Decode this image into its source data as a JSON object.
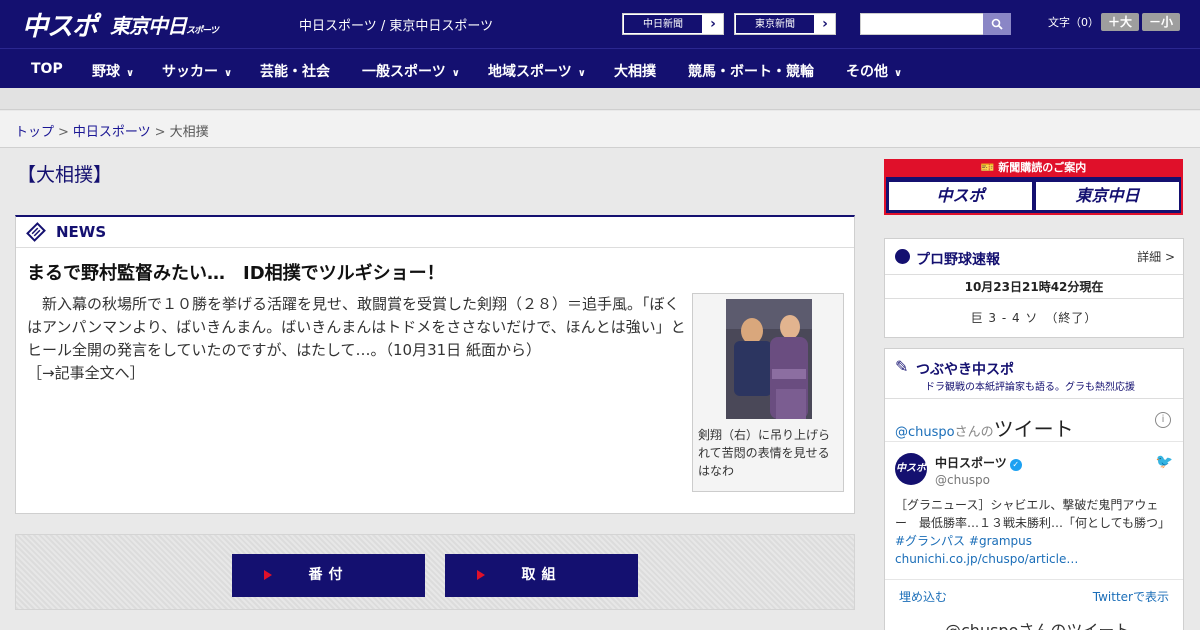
{
  "header": {
    "logo_chuspo": "中スポ",
    "logo_tokyo": "東京中日",
    "logo_tokyo_small": "スポーツ",
    "site_title": "中日スポーツ / 東京中日スポーツ",
    "paper_links": [
      "中日新聞",
      "東京新聞"
    ],
    "font_size_label": "文字（0）",
    "font_larger": "＋大",
    "font_smaller": "－小"
  },
  "nav": {
    "items": [
      "TOP",
      "野球",
      "サッカー",
      "芸能・社会",
      "一般スポーツ",
      "地域スポーツ",
      "大相撲",
      "競馬・ボート・競輪",
      "その他"
    ]
  },
  "breadcrumb": {
    "top": "トップ",
    "chunichi": "中日スポーツ",
    "current": "大相撲",
    "sep": ">"
  },
  "page": {
    "heading": "【大相撲】"
  },
  "news": {
    "label": "NEWS",
    "title": "まるで野村監督みたい…　ID相撲でツルギショー！",
    "body": "　新入幕の秋場所で１０勝を挙げる活躍を見せ、敢闘賞を受賞した剣翔（２８）＝追手風。「ぼくはアンパンマンより、ばいきんまん。ばいきんまんはトドメをささないだけで、ほんとは強い」とヒール全開の発言をしていたのですが、はたして…。（10月31日 紙面から）",
    "more_link": "［→記事全文へ］",
    "photo_caption": "剣翔（右）に吊り上げられて苦悶の表情を見せるはなわ"
  },
  "tabs": [
    "番付",
    "取組"
  ],
  "sidebar": {
    "subscribe_title": "新聞購読のご案内",
    "subscribe_logos": [
      "中スポ",
      "東京中日"
    ],
    "baseball": {
      "title": "プロ野球速報",
      "more": "詳細 >",
      "timestamp": "10月23日21時42分現在",
      "score": "巨 3 - 4 ソ　（終了）"
    },
    "tweets": {
      "title": "つぶやき中スポ",
      "subtitle": "ドラ観戦の本紙評論家も語る。グラも熱烈応援",
      "handle": "@chuspo",
      "handle_suffix": "さんの",
      "tweets_word": "ツイート",
      "account_name": "中日スポーツ",
      "screen_name": "@chuspo",
      "text": "［グラニュース］シャビエル、撃破だ鬼門アウェー　最低勝率…１３戦未勝利…「何としても勝つ」",
      "hashtag1": "#グランパス",
      "hashtag2": "#grampus",
      "link": "chunichi.co.jp/chuspo/article…",
      "embed": "埋め込む",
      "view_on_twitter": "Twitterで表示",
      "tail": "@chuspoさんのツイート"
    }
  },
  "colors": {
    "brand_navy": "#141070",
    "accent_red": "#e0102a",
    "link_blue": "#1b6eb8"
  }
}
